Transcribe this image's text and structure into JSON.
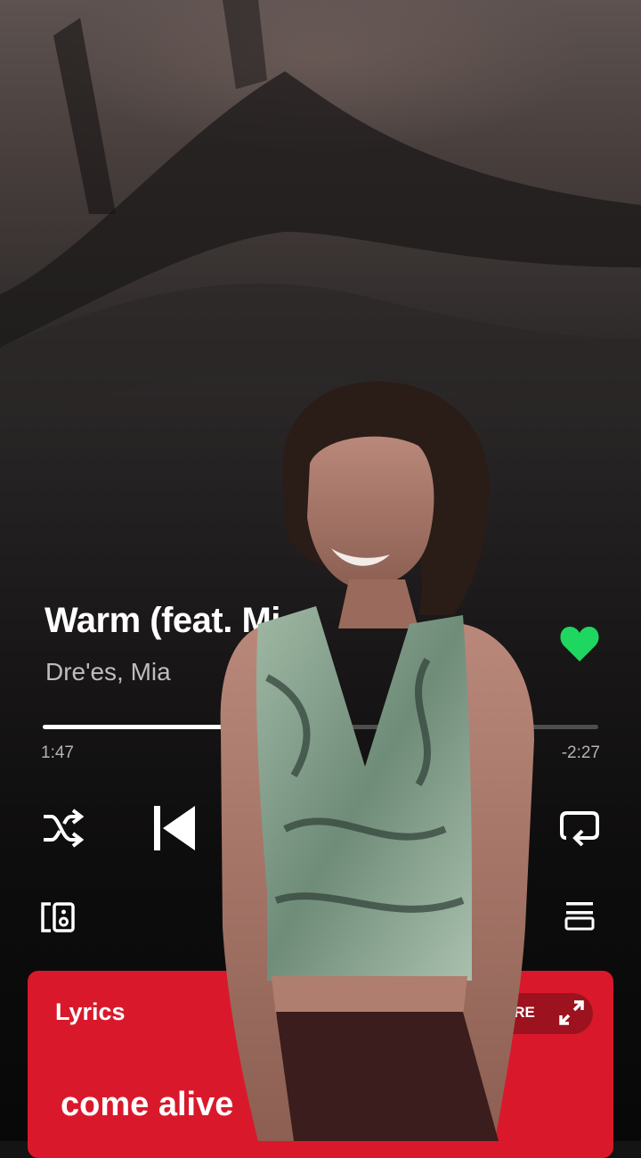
{
  "track": {
    "title": "Warm (feat. Mi",
    "artists": "Dre'es, Mia",
    "liked": true,
    "progress_fraction": 0.42
  },
  "playback": {
    "elapsed": "1:47",
    "remaining": "-2:27"
  },
  "controls": {
    "shuffle_icon": "shuffle-icon",
    "previous_icon": "skip-previous-icon",
    "repeat_icon": "repeat-icon",
    "devices_icon": "connect-device-icon",
    "queue_icon": "queue-icon"
  },
  "lyrics": {
    "title": "Lyrics",
    "more_label": "ORE",
    "current_line": "come alive"
  },
  "colors": {
    "accent_green": "#1ed760",
    "lyrics_card": "#d9192b"
  }
}
